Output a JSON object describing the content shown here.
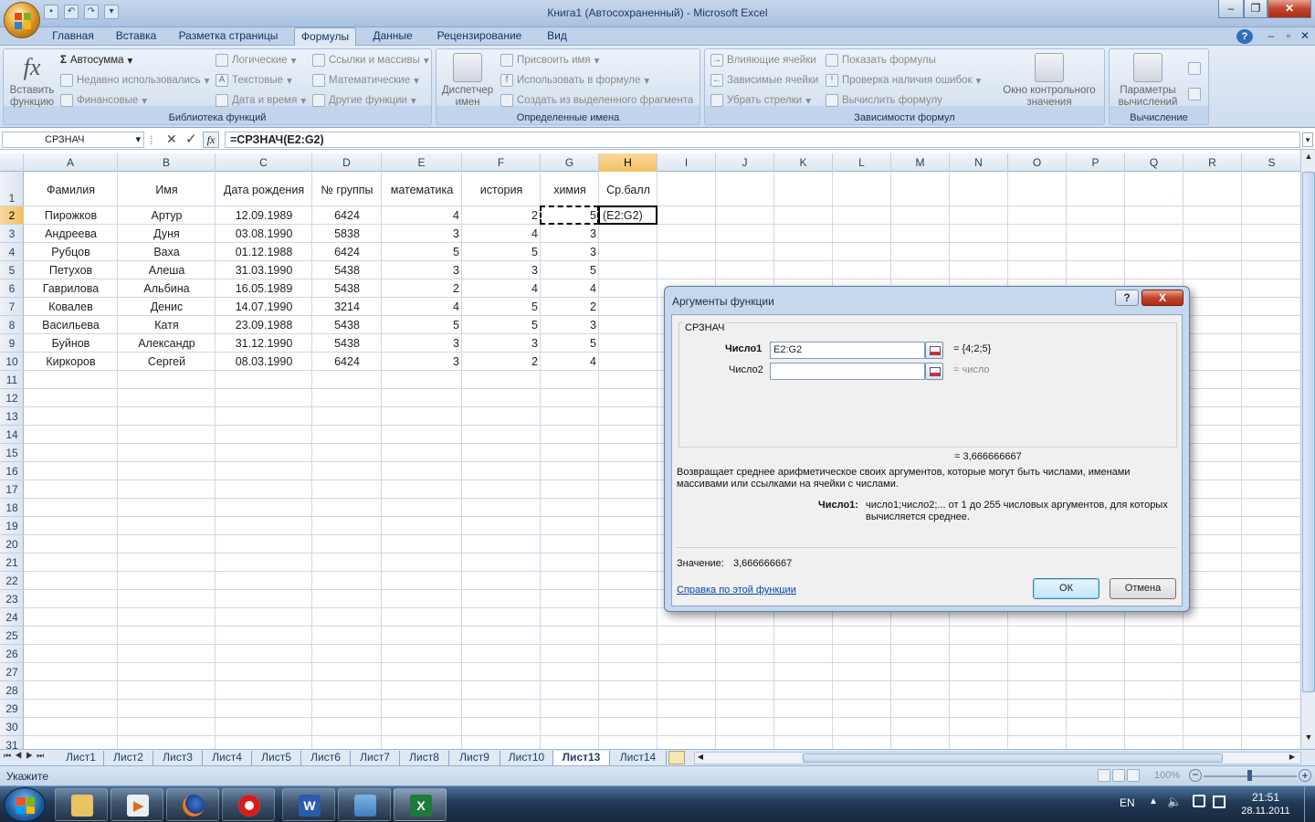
{
  "window": {
    "title": "Книга1 (Автосохраненный) - Microsoft Excel"
  },
  "ribbon_tabs": [
    "Главная",
    "Вставка",
    "Разметка страницы",
    "Формулы",
    "Данные",
    "Рецензирование",
    "Вид"
  ],
  "ribbon": {
    "insert_function": "Вставить функцию",
    "autosum": "Автосумма",
    "recent": "Недавно использовались",
    "financial": "Финансовые",
    "logical": "Логические",
    "text": "Текстовые",
    "datetime": "Дата и время",
    "refs": "Ссылки и массивы",
    "math": "Математические",
    "other": "Другие функции",
    "group_library": "Библиотека функций",
    "name_manager": "Диспетчер имен",
    "assign_name": "Присвоить имя",
    "use_in_formula": "Использовать в формуле",
    "create_from_sel": "Создать из выделенного фрагмента",
    "group_names": "Определенные имена",
    "trace_precedents": "Влияющие ячейки",
    "trace_dependents": "Зависимые ячейки",
    "remove_arrows": "Убрать стрелки",
    "show_formulas": "Показать формулы",
    "error_check": "Проверка наличия ошибок",
    "evaluate": "Вычислить формулу",
    "watch_window": "Окно контрольного значения",
    "group_audit": "Зависимости формул",
    "calc_options": "Параметры вычислений",
    "group_calc": "Вычисление"
  },
  "formula_bar": {
    "name_box": "СРЗНАЧ",
    "fx": "fx",
    "formula": "=СРЗНАЧ(E2:G2)"
  },
  "columns": [
    "A",
    "B",
    "C",
    "D",
    "E",
    "F",
    "G",
    "H",
    "I",
    "J",
    "K",
    "L",
    "M",
    "N",
    "O",
    "P",
    "Q",
    "R",
    "S"
  ],
  "rows": [
    "1",
    "2",
    "3",
    "4",
    "5",
    "6",
    "7",
    "8",
    "9",
    "10",
    "11",
    "12",
    "13",
    "14",
    "15",
    "16",
    "17",
    "18",
    "19",
    "20",
    "21",
    "22",
    "23",
    "24",
    "25",
    "26",
    "27",
    "28",
    "29",
    "30",
    "31"
  ],
  "table": {
    "headers": [
      "Фамилия",
      "Имя",
      "Дата рождения",
      "№ группы",
      "математика",
      "история",
      "химия",
      "Ср.балл"
    ],
    "rows": [
      [
        "Пирожков",
        "Артур",
        "12.09.1989",
        "6424",
        "4",
        "2",
        "5",
        "(E2:G2)"
      ],
      [
        "Андреева",
        "Дуня",
        "03.08.1990",
        "5838",
        "3",
        "4",
        "3",
        ""
      ],
      [
        "Рубцов",
        "Ваха",
        "01.12.1988",
        "6424",
        "5",
        "5",
        "3",
        ""
      ],
      [
        "Петухов",
        "Алеша",
        "31.03.1990",
        "5438",
        "3",
        "3",
        "5",
        ""
      ],
      [
        "Гаврилова",
        "Альбина",
        "16.05.1989",
        "5438",
        "2",
        "4",
        "4",
        ""
      ],
      [
        "Ковалев",
        "Денис",
        "14.07.1990",
        "3214",
        "4",
        "5",
        "2",
        ""
      ],
      [
        "Васильева",
        "Катя",
        "23.09.1988",
        "5438",
        "5",
        "5",
        "3",
        ""
      ],
      [
        "Буйнов",
        "Александр",
        "31.12.1990",
        "5438",
        "3",
        "3",
        "5",
        ""
      ],
      [
        "Киркоров",
        "Сергей",
        "08.03.1990",
        "6424",
        "3",
        "2",
        "4",
        ""
      ]
    ]
  },
  "sheets": [
    "Лист1",
    "Лист2",
    "Лист3",
    "Лист4",
    "Лист5",
    "Лист6",
    "Лист7",
    "Лист8",
    "Лист9",
    "Лист10",
    "Лист13",
    "Лист14"
  ],
  "active_sheet": "Лист13",
  "status": {
    "mode": "Укажите",
    "zoom": "100%"
  },
  "taskbar": {
    "lang": "EN",
    "time": "21:51",
    "date": "28.11.2011"
  },
  "dialog": {
    "title": "Аргументы функции",
    "help_btn": "?",
    "close_btn": "X",
    "function_name": "СРЗНАЧ",
    "arg1_label": "Число1",
    "arg1_value": "E2:G2",
    "arg1_result": "= {4;2;5}",
    "arg2_label": "Число2",
    "arg2_value": "",
    "arg2_result": "= число",
    "result": "= 3,666666667",
    "description": "Возвращает среднее арифметическое своих аргументов, которые могут быть числами, именами массивами или ссылками на ячейки с числами.",
    "arg_help_label": "Число1:",
    "arg_help_text": "число1;число2;... от 1 до 255 числовых аргументов, для которых вычисляется среднее.",
    "value_label": "Значение:",
    "value": "3,666666667",
    "help_link": "Справка по этой функции",
    "ok": "ОК",
    "cancel": "Отмена"
  }
}
